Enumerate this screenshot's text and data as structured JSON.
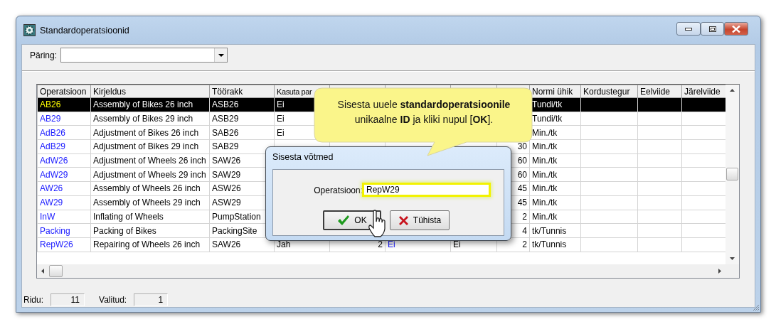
{
  "window": {
    "title": "Standardoperatsioonid"
  },
  "query": {
    "label": "Päring:"
  },
  "table": {
    "columns": [
      {
        "label": "Operatsioon",
        "kind": "link"
      },
      {
        "label": "Kirjeldus",
        "kind": "text"
      },
      {
        "label": "Töörakk",
        "kind": "text"
      },
      {
        "label": "Kasuta par",
        "kind": "text"
      },
      {
        "kind": "number"
      },
      {
        "kind": "link"
      },
      {
        "kind": "text"
      },
      {
        "kind": "number"
      },
      {
        "label": "Normi ühik",
        "kind": "text"
      },
      {
        "label": "Kordustegur",
        "kind": "text"
      },
      {
        "label": "Eelviide",
        "kind": "text"
      },
      {
        "label": "Järelviide",
        "kind": "text"
      }
    ],
    "rows": [
      {
        "selected": true,
        "cells": [
          "AB26",
          "Assembly of Bikes 26 inch",
          "ASB26",
          "Ei",
          null,
          null,
          null,
          null,
          "Tundi/tk"
        ]
      },
      {
        "selected": false,
        "cells": [
          "AB29",
          "Assembly of Bikes 29 inch",
          "ASB29",
          "Ei",
          null,
          null,
          null,
          null,
          "Tundi/tk"
        ]
      },
      {
        "selected": false,
        "cells": [
          "AdB26",
          "Adjustment of Bikes 26 inch",
          "SAB26",
          "Ei",
          null,
          null,
          null,
          null,
          "Min./tk"
        ]
      },
      {
        "selected": false,
        "cells": [
          "AdB29",
          "Adjustment of Bikes 29 inch",
          "SAB29",
          null,
          null,
          null,
          null,
          "30",
          "Min./tk"
        ]
      },
      {
        "selected": false,
        "cells": [
          "AdW26",
          "Adjustment of Wheels 26 inch",
          "SAW26",
          null,
          null,
          null,
          null,
          "60",
          "Min./tk"
        ]
      },
      {
        "selected": false,
        "cells": [
          "AdW29",
          "Adjustment of Wheels 29 inch",
          "SAW29",
          null,
          null,
          null,
          null,
          "60",
          "Min./tk"
        ]
      },
      {
        "selected": false,
        "cells": [
          "AW26",
          "Assembly of Wheels 26 inch",
          "ASW26",
          null,
          null,
          null,
          null,
          "45",
          "Min./tk"
        ]
      },
      {
        "selected": false,
        "cells": [
          "AW29",
          "Assembly of Wheels 29 inch",
          "ASW29",
          null,
          null,
          null,
          null,
          "45",
          "Min./tk"
        ]
      },
      {
        "selected": false,
        "cells": [
          "InW",
          "Inflating of Wheels",
          "PumpStation",
          null,
          null,
          null,
          null,
          "2",
          "Min./tk"
        ]
      },
      {
        "selected": false,
        "cells": [
          "Packing",
          "Packing of Bikes",
          "PackingSite",
          null,
          null,
          null,
          null,
          "4",
          "tk/Tunnis"
        ]
      },
      {
        "selected": false,
        "cells": [
          "RepW26",
          "Repairing of Wheels 26 inch",
          "SAW26",
          "Jah",
          "2",
          "Ei",
          "Ei",
          "2",
          "tk/Tunnis"
        ]
      }
    ]
  },
  "status_bar": [
    {
      "label": "Ridu:",
      "value": "11"
    },
    {
      "label": "Valitud:",
      "value": "1"
    }
  ],
  "dialog": {
    "title": "Sisesta võtmed",
    "field": {
      "label": "Operatsioon:",
      "value": "RepW29",
      "focused": true
    },
    "buttons": [
      {
        "label": "OK",
        "kind": "ok"
      },
      {
        "label": "Tühista",
        "kind": "cancel"
      }
    ]
  },
  "callout": {
    "text": "Sisesta uuele **standardoperatsioonile** unikaalne **ID** ja kliki nupul [**OK**]."
  }
}
